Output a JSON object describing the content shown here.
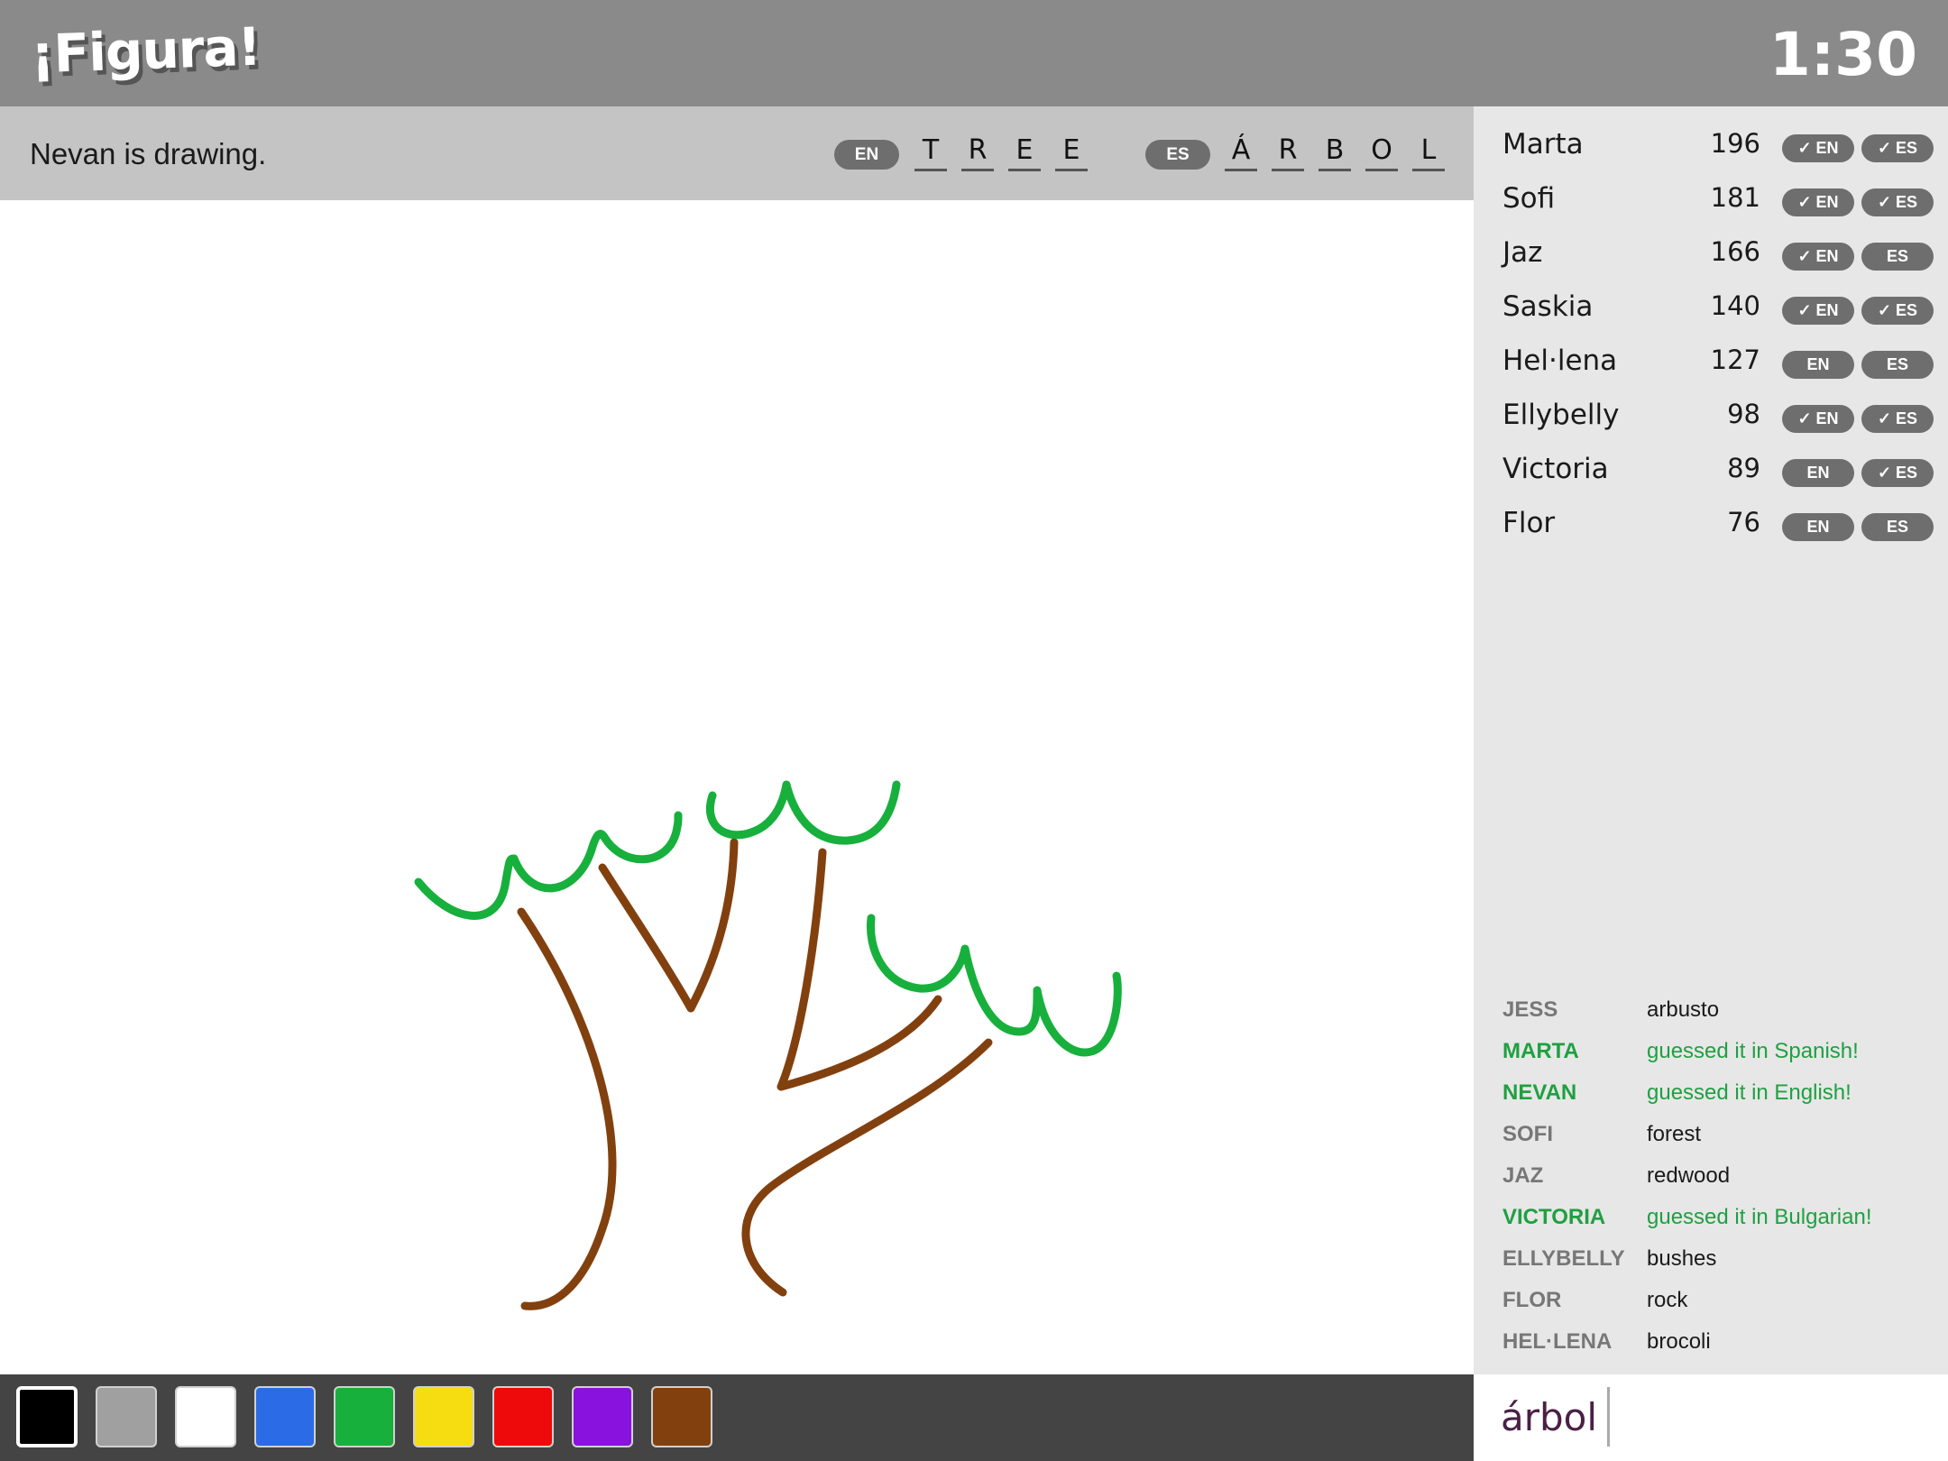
{
  "header": {
    "logo": "¡Figura!",
    "timer": "1:30"
  },
  "status": {
    "drawing_text": "Nevan is drawing.",
    "english": {
      "label": "EN",
      "letters": [
        "T",
        "R",
        "E",
        "E"
      ]
    },
    "spanish": {
      "label": "ES",
      "letters": [
        "Á",
        "R",
        "B",
        "O",
        "L"
      ]
    }
  },
  "players": [
    {
      "name": "Marta",
      "score": "196",
      "en": {
        "label": "EN",
        "guessed": true
      },
      "es": {
        "label": "ES",
        "guessed": true
      }
    },
    {
      "name": "Sofi",
      "score": "181",
      "en": {
        "label": "EN",
        "guessed": true
      },
      "es": {
        "label": "ES",
        "guessed": true
      }
    },
    {
      "name": "Jaz",
      "score": "166",
      "en": {
        "label": "EN",
        "guessed": true
      },
      "es": {
        "label": "ES",
        "guessed": false
      }
    },
    {
      "name": "Saskia",
      "score": "140",
      "en": {
        "label": "EN",
        "guessed": true
      },
      "es": {
        "label": "ES",
        "guessed": true
      }
    },
    {
      "name": "Hel·lena",
      "score": "127",
      "en": {
        "label": "EN",
        "guessed": false
      },
      "es": {
        "label": "ES",
        "guessed": false
      }
    },
    {
      "name": "Ellybelly",
      "score": "98",
      "en": {
        "label": "EN",
        "guessed": true
      },
      "es": {
        "label": "ES",
        "guessed": true
      }
    },
    {
      "name": "Victoria",
      "score": "89",
      "en": {
        "label": "EN",
        "guessed": false
      },
      "es": {
        "label": "ES",
        "guessed": true
      }
    },
    {
      "name": "Flor",
      "score": "76",
      "en": {
        "label": "EN",
        "guessed": false
      },
      "es": {
        "label": "ES",
        "guessed": false
      }
    }
  ],
  "chat": [
    {
      "user": "JESS",
      "message": "arbusto",
      "correct": false
    },
    {
      "user": "MARTA",
      "message": "guessed it in Spanish!",
      "correct": true
    },
    {
      "user": "NEVAN",
      "message": "guessed it in English!",
      "correct": true
    },
    {
      "user": "SOFI",
      "message": "forest",
      "correct": false
    },
    {
      "user": "JAZ",
      "message": "redwood",
      "correct": false
    },
    {
      "user": "VICTORIA",
      "message": "guessed it in Bulgarian!",
      "correct": true
    },
    {
      "user": "ELLYBELLY",
      "message": "bushes",
      "correct": false
    },
    {
      "user": "FLOR",
      "message": "rock",
      "correct": false
    },
    {
      "user": "HEL·LENA",
      "message": "brocoli",
      "correct": false
    }
  ],
  "input": {
    "value": "árbol"
  },
  "palette": {
    "selected": "black",
    "colors": [
      {
        "name": "black",
        "hex": "#000000"
      },
      {
        "name": "gray",
        "hex": "#a0a0a0"
      },
      {
        "name": "white",
        "hex": "#ffffff"
      },
      {
        "name": "blue",
        "hex": "#2b6be6"
      },
      {
        "name": "green",
        "hex": "#17b03c"
      },
      {
        "name": "yellow",
        "hex": "#f5dd12"
      },
      {
        "name": "red",
        "hex": "#ee0a0a"
      },
      {
        "name": "purple",
        "hex": "#8a12de"
      },
      {
        "name": "brown",
        "hex": "#82400f"
      }
    ]
  },
  "drawing": {
    "stroke_colors": {
      "trunk": "#82400f",
      "leaves": "#17b03c"
    }
  }
}
